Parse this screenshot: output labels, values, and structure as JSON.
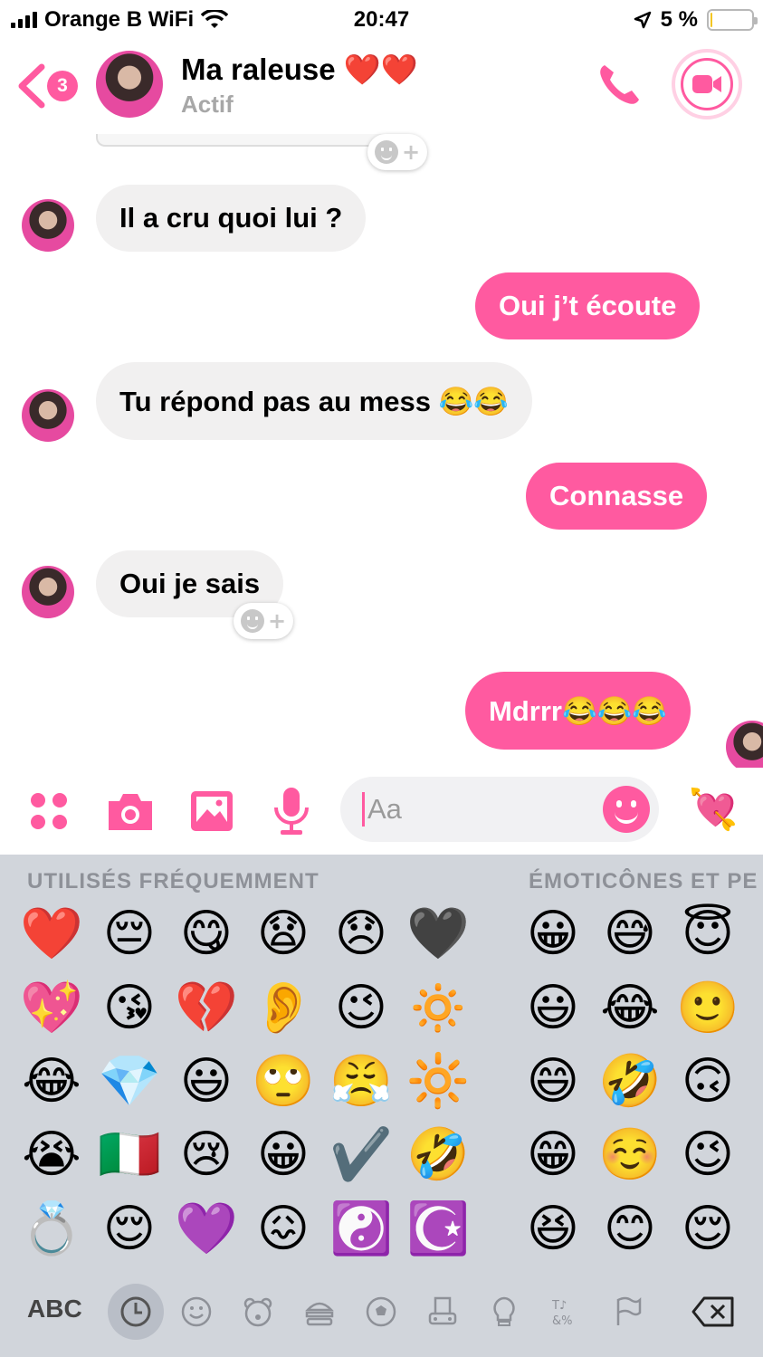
{
  "status_bar": {
    "carrier": "Orange B WiFi",
    "time": "20:47",
    "battery_text": "5 %",
    "battery_level": 0.05,
    "battery_color": "#f3c623"
  },
  "header": {
    "back_badge": "3",
    "contact_name": "Ma raleuse ❤️❤️",
    "contact_status": "Actif",
    "accent_color": "#ff5aa0",
    "icons": [
      "chevron-left-icon",
      "phone-icon",
      "video-camera-icon"
    ]
  },
  "messages": [
    {
      "sender": "them",
      "text": "Il a cru quoi lui ?"
    },
    {
      "sender": "me",
      "text": "Oui j’t écoute"
    },
    {
      "sender": "them",
      "text": "Tu répond pas au mess 😂😂"
    },
    {
      "sender": "me",
      "text": "Connasse"
    },
    {
      "sender": "them",
      "text": "Oui je sais"
    },
    {
      "sender": "me",
      "text": "Mdrrr😂😂😂"
    }
  ],
  "composer": {
    "placeholder": "Aa",
    "icons": [
      "apps-grid-icon",
      "camera-icon",
      "gallery-icon",
      "microphone-icon",
      "smiley-icon",
      "heart-arrow-icon"
    ],
    "send_emoji": "💘"
  },
  "keyboard": {
    "frequent_label": "UTILISÉS FRÉQUEMMENT",
    "smileys_label": "ÉMOTICÔNES ET PE",
    "frequent_rows": [
      [
        "❤️",
        "😔",
        "😋",
        "😧",
        "😞",
        "🖤"
      ],
      [
        "💖",
        "😘",
        "💔",
        "👂",
        "😉",
        "🔅"
      ],
      [
        "😂",
        "💎",
        "😃",
        "🙄",
        "😤",
        "🔆"
      ],
      [
        "😭",
        "🇮🇹",
        "😢",
        "😀",
        "✔️",
        "🤣"
      ],
      [
        "💍",
        "😌",
        "💜",
        "😖",
        "☯️",
        "☪️"
      ]
    ],
    "smiley_rows": [
      [
        "😀",
        "😅",
        "😇"
      ],
      [
        "😃",
        "😂",
        "🙂"
      ],
      [
        "😄",
        "🤣",
        "🙃"
      ],
      [
        "😁",
        "☺️",
        "😉"
      ],
      [
        "😆",
        "😊",
        "😌"
      ]
    ],
    "abc_label": "ABC",
    "category_tabs": [
      "recent-clock-icon",
      "smiley-icon",
      "animal-bear-icon",
      "food-icon",
      "ball-icon",
      "travel-icon",
      "lightbulb-icon",
      "symbols-icon",
      "flag-icon"
    ],
    "delete_icon": "backspace-icon"
  }
}
